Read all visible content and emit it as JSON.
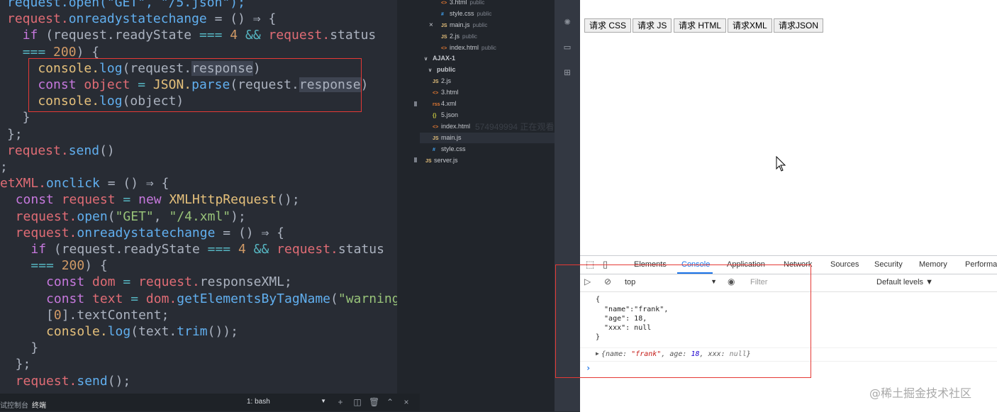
{
  "editor": {
    "lines": [
      [
        [
          "request.open(\"GET\", \"/5.json\");",
          "f"
        ]
      ],
      [
        [
          "request.",
          "v"
        ],
        [
          "onreadystatechange",
          "f"
        ],
        [
          " = () ⇒ {",
          "p"
        ]
      ],
      [
        [
          "  ",
          "p"
        ],
        [
          "if",
          "k"
        ],
        [
          " (request.readyState ",
          "p"
        ],
        [
          "===",
          "c"
        ],
        [
          " 4 ",
          "n"
        ],
        [
          "&&",
          "c"
        ],
        [
          " request.",
          "v"
        ],
        [
          "status",
          "p"
        ]
      ],
      [
        [
          "  ",
          "p"
        ],
        [
          "===",
          "c"
        ],
        [
          " 200",
          "n"
        ],
        [
          ") {",
          "p"
        ]
      ],
      [
        [
          "    console.",
          "y"
        ],
        [
          "log",
          "f"
        ],
        [
          "(request.",
          "p"
        ],
        [
          "response",
          "p"
        ],
        [
          ")",
          "p"
        ]
      ],
      [
        [
          "    ",
          "p"
        ],
        [
          "const",
          "k"
        ],
        [
          " object ",
          "v"
        ],
        [
          "=",
          "c"
        ],
        [
          " JSON.",
          "y"
        ],
        [
          "parse",
          "f"
        ],
        [
          "(request.",
          "p"
        ],
        [
          "response",
          "p"
        ],
        [
          ")",
          "p"
        ]
      ],
      [
        [
          "    console.",
          "y"
        ],
        [
          "log",
          "f"
        ],
        [
          "(object)",
          "p"
        ]
      ],
      [
        [
          "  }",
          "p"
        ]
      ],
      [
        [
          "};",
          "p"
        ]
      ],
      [
        [
          "request.",
          "v"
        ],
        [
          "send",
          "f"
        ],
        [
          "()",
          "p"
        ]
      ],
      [
        [
          ";",
          "p"
        ]
      ],
      [
        [
          "etXML.",
          "v"
        ],
        [
          "onclick",
          "f"
        ],
        [
          " = () ⇒ {",
          "p"
        ]
      ],
      [
        [
          "  ",
          "p"
        ],
        [
          "const",
          "k"
        ],
        [
          " request ",
          "v"
        ],
        [
          "=",
          "c"
        ],
        [
          " new ",
          "k"
        ],
        [
          "XMLHttpRequest",
          "y"
        ],
        [
          "();",
          "p"
        ]
      ],
      [
        [
          "  request.",
          "v"
        ],
        [
          "open",
          "f"
        ],
        [
          "(",
          "p"
        ],
        [
          "\"GET\"",
          "s"
        ],
        [
          ", ",
          "p"
        ],
        [
          "\"/4.xml\"",
          "s"
        ],
        [
          ");",
          "p"
        ]
      ],
      [
        [
          "  request.",
          "v"
        ],
        [
          "onreadystatechange",
          "f"
        ],
        [
          " = () ⇒ {",
          "p"
        ]
      ],
      [
        [
          "    ",
          "p"
        ],
        [
          "if",
          "k"
        ],
        [
          " (request.readyState ",
          "p"
        ],
        [
          "===",
          "c"
        ],
        [
          " 4 ",
          "n"
        ],
        [
          "&&",
          "c"
        ],
        [
          " request.",
          "v"
        ],
        [
          "status",
          "p"
        ]
      ],
      [
        [
          "    ",
          "p"
        ],
        [
          "===",
          "c"
        ],
        [
          " 200",
          "n"
        ],
        [
          ") {",
          "p"
        ]
      ],
      [
        [
          "      ",
          "p"
        ],
        [
          "const",
          "k"
        ],
        [
          " dom ",
          "v"
        ],
        [
          "=",
          "c"
        ],
        [
          " request.",
          "v"
        ],
        [
          "responseXML",
          "p"
        ],
        [
          ";",
          "p"
        ]
      ],
      [
        [
          "      ",
          "p"
        ],
        [
          "const",
          "k"
        ],
        [
          " text ",
          "v"
        ],
        [
          "=",
          "c"
        ],
        [
          " dom.",
          "v"
        ],
        [
          "getElementsByTagName",
          "f"
        ],
        [
          "(",
          "p"
        ],
        [
          "\"warning\"",
          "s"
        ],
        [
          ")",
          "p"
        ]
      ],
      [
        [
          "      [",
          "p"
        ],
        [
          "0",
          "n"
        ],
        [
          "].textContent;",
          "p"
        ]
      ],
      [
        [
          "      console.",
          "y"
        ],
        [
          "log",
          "f"
        ],
        [
          "(text.",
          "p"
        ],
        [
          "trim",
          "f"
        ],
        [
          "());",
          "p"
        ]
      ],
      [
        [
          "    }",
          "p"
        ]
      ],
      [
        [
          "  };",
          "p"
        ]
      ],
      [
        [
          "  request.",
          "v"
        ],
        [
          "send",
          "f"
        ],
        [
          "();",
          "p"
        ]
      ]
    ]
  },
  "terminal": {
    "tab_debug": "试控制台",
    "tab_terminal": "终端",
    "shell": "1: bash",
    "arrow": "▼",
    "icons": {
      "add": "+",
      "split": "◫",
      "trash": "🗑",
      "up": "⌃",
      "close": "×"
    }
  },
  "explorer": {
    "items": [
      {
        "label": "3.html",
        "hint": "public",
        "icon": "<>",
        "type": "html"
      },
      {
        "label": "style.css",
        "hint": "public",
        "icon": "#",
        "type": "css"
      },
      {
        "label": "main.js",
        "hint": "public",
        "icon": "JS",
        "type": "js",
        "close": "×"
      },
      {
        "label": "2.js",
        "hint": "public",
        "icon": "JS",
        "type": "js"
      },
      {
        "label": "index.html",
        "hint": "public",
        "icon": "<>",
        "type": "html"
      },
      {
        "label": "AJAX-1",
        "hint": "",
        "icon": "∨",
        "type": "folder"
      },
      {
        "label": "public",
        "hint": "",
        "icon": "∨",
        "type": "folder"
      },
      {
        "label": "2.js",
        "hint": "",
        "icon": "JS",
        "type": "js"
      },
      {
        "label": "3.html",
        "hint": "",
        "icon": "<>",
        "type": "html"
      },
      {
        "label": "4.xml",
        "hint": "",
        "icon": "rss",
        "type": "xml"
      },
      {
        "label": "5.json",
        "hint": "",
        "icon": "{}",
        "type": "json"
      },
      {
        "label": "index.html",
        "hint": "",
        "icon": "<>",
        "type": "html"
      },
      {
        "label": "main.js",
        "hint": "",
        "icon": "JS",
        "type": "js"
      },
      {
        "label": "style.css",
        "hint": "",
        "icon": "#",
        "type": "css"
      },
      {
        "label": "server.js",
        "hint": "",
        "icon": "JS",
        "type": "js"
      }
    ],
    "live_watermark": "574949994 正在观看"
  },
  "browser": {
    "buttons": [
      "请求 CSS",
      "请求 JS",
      "请求 HTML",
      "请求XML",
      "请求JSON"
    ]
  },
  "devtools": {
    "tabs": [
      "Elements",
      "Console",
      "Application",
      "Network",
      "Sources",
      "Security",
      "Memory",
      "Performa"
    ],
    "active_tab": "Console",
    "context": "top",
    "context_arrow": "▼",
    "filter_placeholder": "Filter",
    "levels": "Default levels ▼",
    "json_lines": [
      "{",
      "  \"name\":\"frank\",",
      "  \"age\": 18,",
      "  \"xxx\": null",
      "}"
    ],
    "object_prefix": "▶",
    "object_preview": [
      [
        "{",
        "o-k"
      ],
      [
        "name: ",
        "o-k"
      ],
      [
        "\"frank\"",
        "o-s"
      ],
      [
        ", age: ",
        "o-k"
      ],
      [
        "18",
        "o-n"
      ],
      [
        ", xxx: ",
        "o-k"
      ],
      [
        "null",
        "o-nl"
      ],
      [
        "}",
        "o-k"
      ]
    ],
    "prompt": "›"
  },
  "watermark": "@稀土掘金技术社区"
}
